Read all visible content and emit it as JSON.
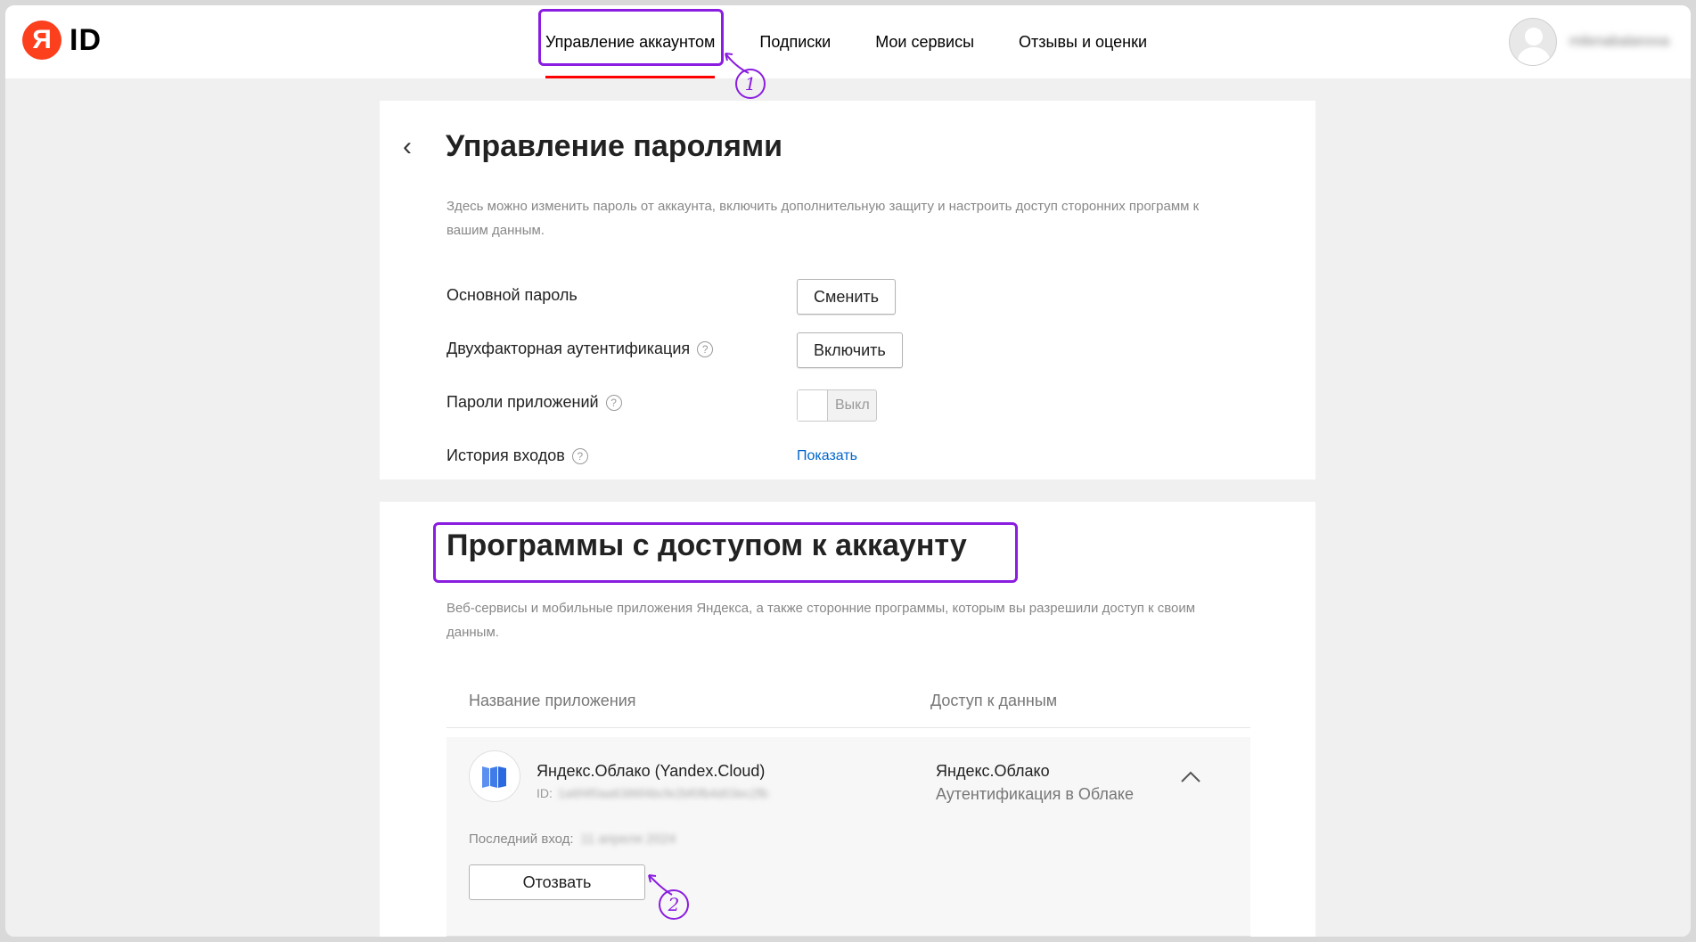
{
  "logo": {
    "letter": "Я",
    "text": "ID"
  },
  "nav": {
    "items": [
      {
        "label": "Управление аккаунтом",
        "active": true
      },
      {
        "label": "Подписки"
      },
      {
        "label": "Мои сервисы"
      },
      {
        "label": "Отзывы и оценки"
      }
    ]
  },
  "user": {
    "name": "milenabalanova"
  },
  "password_section": {
    "title": "Управление паролями",
    "description": "Здесь можно изменить пароль от аккаунта, включить дополнительную защиту и настроить доступ сторонних программ к вашим данным.",
    "rows": [
      {
        "label": "Основной пароль",
        "action": "Сменить"
      },
      {
        "label": "Двухфакторная аутентификация",
        "help": "?",
        "action": "Включить"
      },
      {
        "label": "Пароли приложений",
        "help": "?",
        "toggle": "Выкл"
      },
      {
        "label": "История входов",
        "help": "?",
        "link": "Показать"
      }
    ]
  },
  "apps_section": {
    "title": "Программы с доступом к аккаунту",
    "description": "Веб-сервисы и мобильные приложения Яндекса, а также сторонние программы, которым вы разрешили доступ к своим данным.",
    "table_headers": [
      "Название приложения",
      "Доступ к данным"
    ],
    "app": {
      "name": "Яндекс.Облако (Yandex.Cloud)",
      "id_label": "ID:",
      "id_value": "1a6f4f0aa6386f4bcfe2bf0fb4d03ec2fb",
      "access_name": "Яндекс.Облако",
      "access_desc": "Аутентификация в Облаке",
      "last_login_label": "Последний вход:",
      "last_login_value": "11 апреля 2024",
      "revoke_label": "Отозвать"
    }
  },
  "markers": {
    "m1": "1",
    "m2": "2"
  },
  "colors": {
    "accent": "#8a1de0",
    "brand": "#fc3f1d",
    "link": "#0066cc",
    "active_underline": "#ff0000"
  }
}
